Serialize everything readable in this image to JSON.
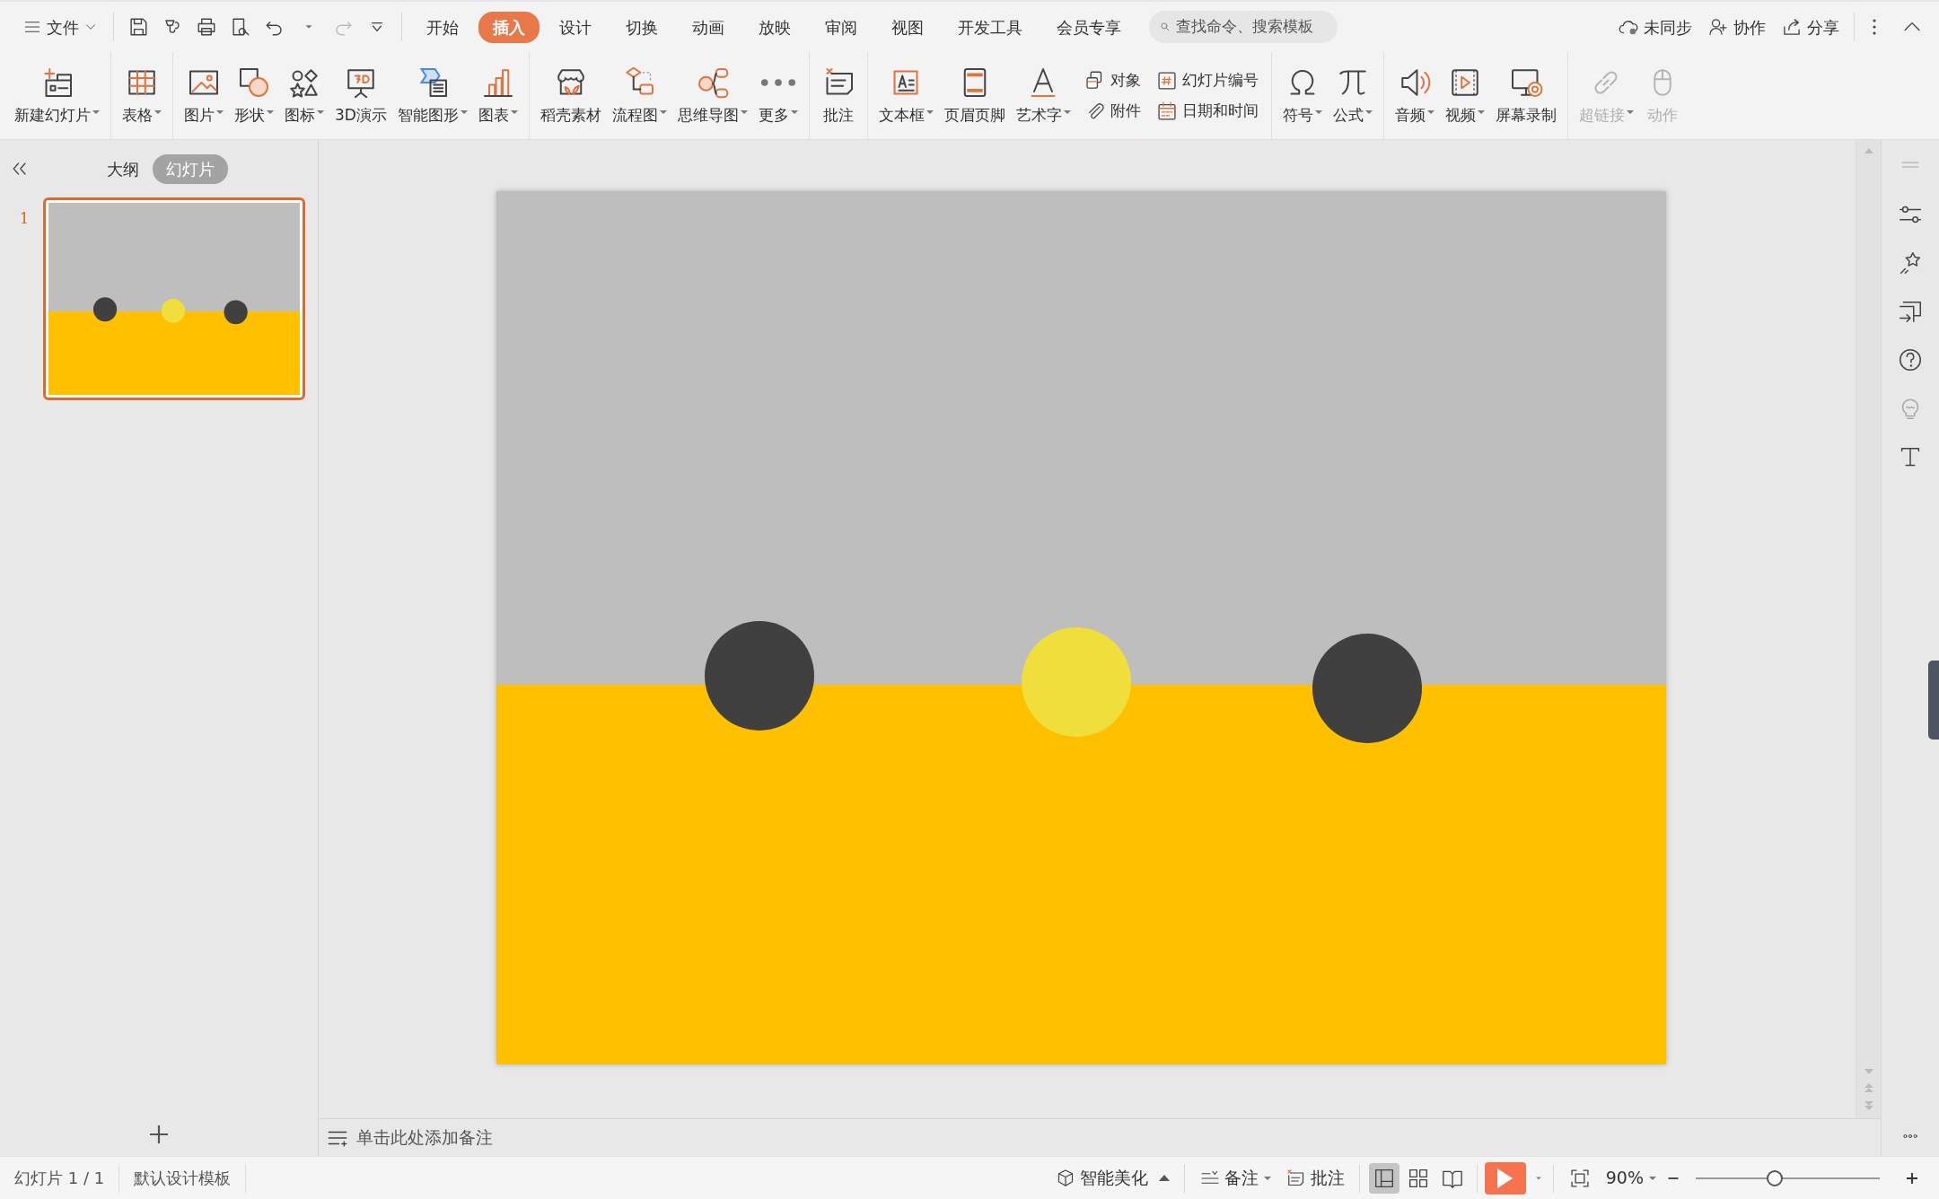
{
  "menu": {
    "file": "文件",
    "tabs": [
      {
        "label": "开始",
        "selected": false
      },
      {
        "label": "插入",
        "selected": true
      },
      {
        "label": "设计",
        "selected": false
      },
      {
        "label": "切换",
        "selected": false
      },
      {
        "label": "动画",
        "selected": false
      },
      {
        "label": "放映",
        "selected": false
      },
      {
        "label": "审阅",
        "selected": false
      },
      {
        "label": "视图",
        "selected": false
      },
      {
        "label": "开发工具",
        "selected": false
      },
      {
        "label": "会员专享",
        "selected": false
      }
    ],
    "search": {
      "placeholder": "查找命令、搜索模板"
    },
    "actions": [
      "未同步",
      "协作",
      "分享"
    ]
  },
  "ribbon": [
    {
      "items": [
        {
          "kind": "large",
          "label": "新建幻灯片",
          "dropdown": true,
          "disabled": false
        }
      ]
    },
    {
      "items": [
        {
          "kind": "large",
          "label": "表格",
          "dropdown": true,
          "disabled": false
        }
      ]
    },
    {
      "items": [
        {
          "kind": "large",
          "label": "图片",
          "dropdown": true,
          "disabled": false
        },
        {
          "kind": "large",
          "label": "形状",
          "dropdown": true,
          "disabled": false
        },
        {
          "kind": "large",
          "label": "图标",
          "dropdown": true,
          "disabled": false
        },
        {
          "kind": "large",
          "label": "3D演示",
          "dropdown": false,
          "disabled": false
        },
        {
          "kind": "large",
          "label": "智能图形",
          "dropdown": true,
          "disabled": false
        },
        {
          "kind": "large",
          "label": "图表",
          "dropdown": true,
          "disabled": false
        }
      ]
    },
    {
      "items": [
        {
          "kind": "large",
          "label": "稻壳素材",
          "dropdown": false,
          "disabled": false
        },
        {
          "kind": "large",
          "label": "流程图",
          "dropdown": true,
          "disabled": false
        },
        {
          "kind": "large",
          "label": "思维导图",
          "dropdown": true,
          "disabled": false
        },
        {
          "kind": "large",
          "label": "更多",
          "dropdown": true,
          "disabled": false
        }
      ]
    },
    {
      "items": [
        {
          "kind": "large",
          "label": "批注",
          "dropdown": false,
          "disabled": false
        }
      ]
    },
    {
      "items": [
        {
          "kind": "large",
          "label": "文本框",
          "dropdown": true,
          "disabled": false
        },
        {
          "kind": "large",
          "label": "页眉页脚",
          "dropdown": false,
          "disabled": false
        },
        {
          "kind": "large",
          "label": "艺术字",
          "dropdown": true,
          "disabled": false
        },
        {
          "kind": "stack",
          "items": [
            {
              "label": "对象",
              "disabled": false
            },
            {
              "label": "附件",
              "disabled": false
            }
          ]
        },
        {
          "kind": "stack",
          "items": [
            {
              "label": "幻灯片编号",
              "disabled": false
            },
            {
              "label": "日期和时间",
              "disabled": false
            }
          ]
        }
      ]
    },
    {
      "items": [
        {
          "kind": "large",
          "label": "符号",
          "dropdown": true,
          "disabled": false
        },
        {
          "kind": "large",
          "label": "公式",
          "dropdown": true,
          "disabled": false
        }
      ]
    },
    {
      "items": [
        {
          "kind": "large",
          "label": "音频",
          "dropdown": true,
          "disabled": false
        },
        {
          "kind": "large",
          "label": "视频",
          "dropdown": true,
          "disabled": false
        },
        {
          "kind": "large",
          "label": "屏幕录制",
          "dropdown": false,
          "disabled": false
        }
      ]
    },
    {
      "items": [
        {
          "kind": "large",
          "label": "超链接",
          "dropdown": true,
          "disabled": true
        },
        {
          "kind": "large",
          "label": "动作",
          "dropdown": false,
          "disabled": true
        }
      ]
    }
  ],
  "left_panel": {
    "tabs": [
      {
        "label": "大纲",
        "selected": false
      },
      {
        "label": "幻灯片",
        "selected": true
      }
    ],
    "slides": [
      {
        "number": "1",
        "selected": true
      }
    ]
  },
  "slide": {
    "shapes": [
      {
        "color": "#404040"
      },
      {
        "color": "#f0de3c"
      },
      {
        "color": "#404040"
      }
    ]
  },
  "notes": {
    "placeholder": "单击此处添加备注"
  },
  "status_bar": {
    "slide": "幻灯片 1 / 1",
    "template": "默认设计模板",
    "beautify": "智能美化",
    "notes": "备注",
    "comments": "批注",
    "views": [
      {
        "selected": true
      },
      {
        "selected": false
      },
      {
        "selected": false
      }
    ],
    "zoom": "90%",
    "zoom_slider": {
      "level": 0.43
    }
  }
}
